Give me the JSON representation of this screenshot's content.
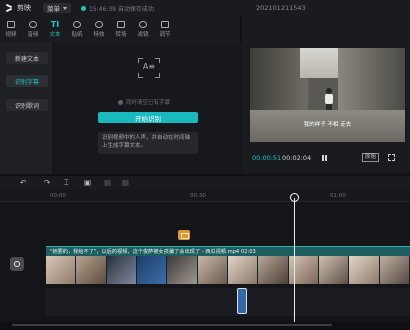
{
  "titlebar": {
    "app_name": "剪映",
    "menu_label": "菜单",
    "save_status": "15:46:39 自动保存成功",
    "project_name": "202101211543"
  },
  "tabs": [
    {
      "label": "视频",
      "icon": "video-icon"
    },
    {
      "label": "音频",
      "icon": "audio-icon"
    },
    {
      "label": "文本",
      "icon": "text-icon",
      "active": true
    },
    {
      "label": "贴纸",
      "icon": "sticker-icon"
    },
    {
      "label": "特效",
      "icon": "effects-icon"
    },
    {
      "label": "转场",
      "icon": "transition-icon"
    },
    {
      "label": "滤镜",
      "icon": "filter-icon"
    },
    {
      "label": "调节",
      "icon": "adjust-icon"
    }
  ],
  "subsidebar": {
    "items": [
      "新建文本",
      "识别字幕",
      "识别歌词"
    ],
    "active_index": 1
  },
  "caption_panel": {
    "icon_text": "A≡",
    "clear_option": "同时清空已有字幕",
    "start_button": "开始识别",
    "tip": "识别视频中的人声，并自动在时间轴上生成字幕文本。"
  },
  "preview": {
    "subtitle": "我的样子 不相  走去",
    "current_time": "00:00:51",
    "total_time": "00:02:04",
    "ratio_label": "原始"
  },
  "timeline": {
    "ruler_ticks": [
      "00:00",
      "00:30",
      "01:00"
    ],
    "clip_label": "\"她要的，我给不了\"，以后的视频，这个俊萨被女孩骗了会出现了 - 西瓜视频.mp4    02:03",
    "accent_color": "#19c8c3"
  }
}
